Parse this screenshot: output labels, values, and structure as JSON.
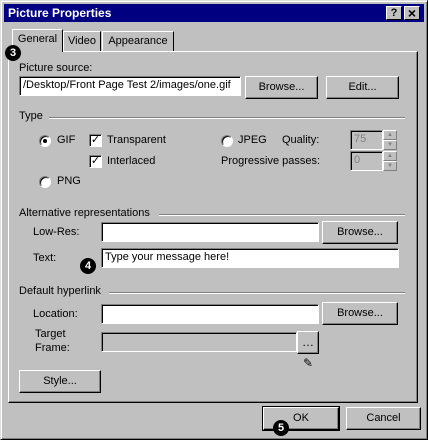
{
  "window": {
    "title": "Picture Properties",
    "help_button": "?",
    "close_button": "×"
  },
  "tabs": [
    {
      "label": "General",
      "active": true
    },
    {
      "label": "Video",
      "active": false
    },
    {
      "label": "Appearance",
      "active": false
    }
  ],
  "markers": [
    "3",
    "4",
    "5"
  ],
  "source": {
    "label": "Picture source:",
    "value": "/Desktop/Front Page Test 2/images/one.gif",
    "browse_label": "Browse...",
    "edit_label": "Edit..."
  },
  "type": {
    "section_label": "Type",
    "gif_label": "GIF",
    "gif_selected": true,
    "png_label": "PNG",
    "jpeg_label": "JPEG",
    "transparent_label": "Transparent",
    "transparent_checked": true,
    "interlaced_label": "Interlaced",
    "interlaced_checked": true,
    "quality_label": "Quality:",
    "quality_value": "75",
    "progressive_label": "Progressive passes:",
    "progressive_value": "0"
  },
  "alt": {
    "section_label": "Alternative representations",
    "lowres_label": "Low-Res:",
    "lowres_value": "",
    "browse_label": "Browse...",
    "text_label": "Text:",
    "text_value": "Type your message here!"
  },
  "hyperlink": {
    "section_label": "Default hyperlink",
    "location_label": "Location:",
    "location_value": "",
    "browse_label": "Browse...",
    "target_label_1": "Target",
    "target_label_2": "Frame:",
    "target_value": ""
  },
  "style_button": "Style...",
  "footer": {
    "ok_label": "OK",
    "cancel_label": "Cancel"
  }
}
